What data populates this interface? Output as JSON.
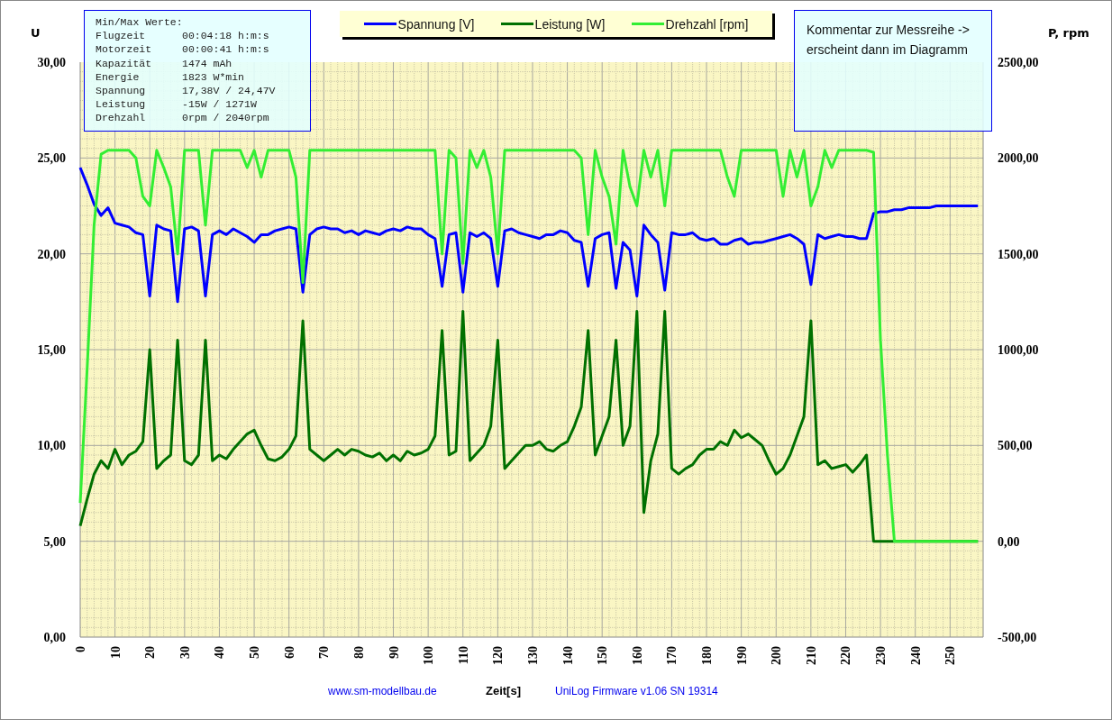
{
  "info_box": {
    "title": "Min/Max Werte:",
    "rows": [
      {
        "label": "Flugzeit",
        "value": "00:04:18 h:m:s"
      },
      {
        "label": "Motorzeit",
        "value": "00:00:41 h:m:s"
      },
      {
        "label": "Kapazität",
        "value": "1474 mAh"
      },
      {
        "label": "Energie",
        "value": "1823 W*min"
      },
      {
        "label": "Spannung",
        "value": "17,38V / 24,47V"
      },
      {
        "label": "Leistung",
        "value": "-15W / 1271W"
      },
      {
        "label": "Drehzahl",
        "value": "0rpm / 2040rpm"
      }
    ]
  },
  "comment": {
    "lines": [
      "Kommentar zur Messreihe ->",
      "erscheint dann im Diagramm"
    ]
  },
  "footer": {
    "website": "www.sm-modellbau.de",
    "firmware": "UniLog Firmware v1.06 SN 19314"
  },
  "chart_data": {
    "type": "line",
    "grid": true,
    "xlabel": "Zeit[s]",
    "ylabel": "U",
    "y2label": "P, rpm",
    "xlim": [
      0,
      259.5
    ],
    "ylim": [
      0,
      30
    ],
    "y2lim": [
      -500,
      2500
    ],
    "xticks": [
      0,
      10,
      20,
      30,
      40,
      50,
      60,
      70,
      80,
      90,
      100,
      110,
      120,
      130,
      140,
      150,
      160,
      170,
      180,
      190,
      200,
      210,
      220,
      230,
      240,
      250
    ],
    "yticks": [
      {
        "value": 0,
        "label": "0,00"
      },
      {
        "value": 5,
        "label": "5,00"
      },
      {
        "value": 10,
        "label": "10,00"
      },
      {
        "value": 15,
        "label": "15,00"
      },
      {
        "value": 20,
        "label": "20,00"
      },
      {
        "value": 25,
        "label": "25,00"
      },
      {
        "value": 30,
        "label": "30,00"
      }
    ],
    "y2ticks": [
      {
        "value": -500,
        "label": "-500,00"
      },
      {
        "value": 0,
        "label": "0,00"
      },
      {
        "value": 500,
        "label": "500,00"
      },
      {
        "value": 1000,
        "label": "1000,00"
      },
      {
        "value": 1500,
        "label": "1500,00"
      },
      {
        "value": 2000,
        "label": "2000,00"
      },
      {
        "value": 2500,
        "label": "2500,00"
      }
    ],
    "x": [
      0,
      2,
      4,
      6,
      8,
      10,
      12,
      14,
      16,
      18,
      20,
      22,
      24,
      26,
      28,
      30,
      32,
      34,
      36,
      38,
      40,
      42,
      44,
      46,
      48,
      50,
      52,
      54,
      56,
      58,
      60,
      62,
      64,
      66,
      68,
      70,
      72,
      74,
      76,
      78,
      80,
      82,
      84,
      86,
      88,
      90,
      92,
      94,
      96,
      98,
      100,
      102,
      104,
      106,
      108,
      110,
      112,
      114,
      116,
      118,
      120,
      122,
      124,
      126,
      128,
      130,
      132,
      134,
      136,
      138,
      140,
      142,
      144,
      146,
      148,
      150,
      152,
      154,
      156,
      158,
      160,
      162,
      164,
      166,
      168,
      170,
      172,
      174,
      176,
      178,
      180,
      182,
      184,
      186,
      188,
      190,
      192,
      194,
      196,
      198,
      200,
      202,
      204,
      206,
      208,
      210,
      212,
      214,
      216,
      218,
      220,
      222,
      224,
      226,
      228,
      230,
      232,
      234,
      236,
      238,
      240,
      242,
      244,
      246,
      248,
      250,
      252,
      254,
      256,
      258
    ],
    "series": [
      {
        "name": "Spannung [V]",
        "color": "#0000ff",
        "axis": "y",
        "values": [
          24.5,
          23.6,
          22.6,
          22.0,
          22.4,
          21.6,
          21.5,
          21.4,
          21.1,
          21.0,
          17.8,
          21.5,
          21.3,
          21.2,
          17.5,
          21.3,
          21.4,
          21.2,
          17.8,
          21.0,
          21.2,
          21.0,
          21.3,
          21.1,
          20.9,
          20.6,
          21.0,
          21.0,
          21.2,
          21.3,
          21.4,
          21.3,
          18.0,
          21.0,
          21.3,
          21.4,
          21.3,
          21.3,
          21.1,
          21.2,
          21.0,
          21.2,
          21.1,
          21.0,
          21.2,
          21.3,
          21.2,
          21.4,
          21.3,
          21.3,
          21.0,
          20.8,
          18.3,
          21.0,
          21.1,
          18.0,
          21.1,
          20.9,
          21.1,
          20.8,
          18.3,
          21.2,
          21.3,
          21.1,
          21.0,
          20.9,
          20.8,
          21.0,
          21.0,
          21.2,
          21.1,
          20.7,
          20.6,
          18.3,
          20.8,
          21.0,
          21.1,
          18.2,
          20.6,
          20.2,
          17.8,
          21.5,
          21.0,
          20.6,
          18.1,
          21.1,
          21.0,
          21.0,
          21.1,
          20.8,
          20.7,
          20.8,
          20.5,
          20.5,
          20.7,
          20.8,
          20.5,
          20.6,
          20.6,
          20.7,
          20.8,
          20.9,
          21.0,
          20.8,
          20.5,
          18.4,
          21.0,
          20.8,
          20.9,
          21.0,
          20.9,
          20.9,
          20.8,
          20.8,
          22.1,
          22.2,
          22.2,
          22.3,
          22.3,
          22.4,
          22.4,
          22.4,
          22.4,
          22.5,
          22.5,
          22.5,
          22.5,
          22.5,
          22.5,
          22.5
        ]
      },
      {
        "name": "Leistung [W]",
        "color": "#007000",
        "axis": "y2",
        "values": [
          80,
          220,
          350,
          420,
          380,
          480,
          400,
          450,
          470,
          520,
          1000,
          380,
          420,
          450,
          1050,
          420,
          400,
          450,
          1050,
          420,
          450,
          430,
          480,
          520,
          560,
          580,
          500,
          430,
          420,
          440,
          480,
          550,
          1150,
          480,
          450,
          420,
          450,
          480,
          450,
          480,
          470,
          450,
          440,
          460,
          420,
          450,
          420,
          470,
          450,
          460,
          480,
          550,
          1100,
          450,
          470,
          1200,
          420,
          460,
          500,
          600,
          1050,
          380,
          420,
          460,
          500,
          500,
          520,
          480,
          470,
          500,
          520,
          600,
          700,
          1100,
          450,
          550,
          650,
          1050,
          500,
          600,
          1200,
          150,
          420,
          560,
          1200,
          380,
          350,
          380,
          400,
          450,
          480,
          480,
          520,
          500,
          580,
          540,
          560,
          530,
          500,
          420,
          350,
          380,
          450,
          550,
          650,
          1150,
          400,
          420,
          380,
          390,
          400,
          360,
          400,
          450,
          0,
          0,
          0,
          0,
          0,
          0,
          0,
          0,
          0,
          0,
          0,
          0,
          0,
          0,
          0,
          0
        ]
      },
      {
        "name": "Drehzahl [rpm]",
        "color": "#33ee33",
        "axis": "y2",
        "values": [
          200,
          900,
          1650,
          2020,
          2040,
          2040,
          2040,
          2040,
          2000,
          1800,
          1750,
          2040,
          1950,
          1850,
          1500,
          2040,
          2040,
          2040,
          1650,
          2040,
          2040,
          2040,
          2040,
          2040,
          1950,
          2040,
          1900,
          2040,
          2040,
          2040,
          2040,
          1900,
          1350,
          2040,
          2040,
          2040,
          2040,
          2040,
          2040,
          2040,
          2040,
          2040,
          2040,
          2040,
          2040,
          2040,
          2040,
          2040,
          2040,
          2040,
          2040,
          2040,
          1500,
          2040,
          2000,
          1450,
          2040,
          1950,
          2040,
          1900,
          1500,
          2040,
          2040,
          2040,
          2040,
          2040,
          2040,
          2040,
          2040,
          2040,
          2040,
          2040,
          2000,
          1600,
          2040,
          1900,
          1800,
          1550,
          2040,
          1850,
          1750,
          2040,
          1900,
          2040,
          1750,
          2040,
          2040,
          2040,
          2040,
          2040,
          2040,
          2040,
          2040,
          1900,
          1800,
          2040,
          2040,
          2040,
          2040,
          2040,
          2040,
          1800,
          2040,
          1900,
          2040,
          1750,
          1850,
          2040,
          1950,
          2040,
          2040,
          2040,
          2040,
          2040,
          2030,
          1050,
          450,
          0,
          0,
          0,
          0,
          0,
          0,
          0,
          0,
          0,
          0,
          0,
          0,
          0
        ]
      }
    ]
  }
}
